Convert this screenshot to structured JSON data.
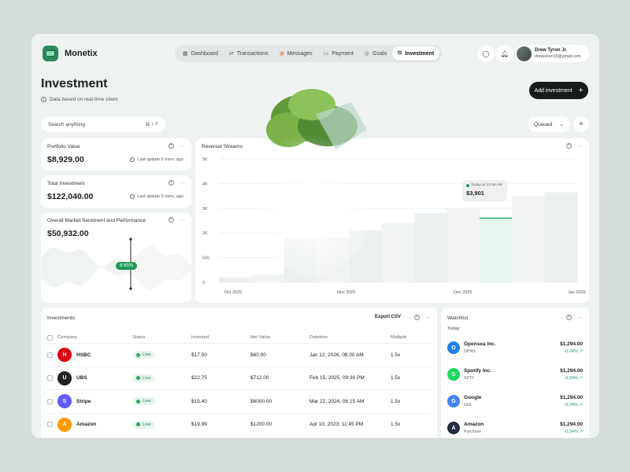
{
  "app": {
    "name": "Monetix"
  },
  "nav": [
    {
      "label": "Dashboard",
      "icon": "grid-icon"
    },
    {
      "label": "Transactions",
      "icon": "swap-icon"
    },
    {
      "label": "Messages",
      "icon": "chat-icon"
    },
    {
      "label": "Payment",
      "icon": "card-icon"
    },
    {
      "label": "Goals",
      "icon": "target-icon"
    },
    {
      "label": "Investment",
      "icon": "chart-icon",
      "active": true
    }
  ],
  "user": {
    "name": "Drew Tyron Jr.",
    "email": "drewishen15@gmail.com"
  },
  "page": {
    "title": "Investment",
    "subtitle": "Data based on real-time client"
  },
  "actions": {
    "add": "Add investment"
  },
  "search": {
    "placeholder": "Search anything",
    "shortcut": "⌘ + F"
  },
  "filter": {
    "selected": "Queued"
  },
  "cards": {
    "portfolio": {
      "title": "Portfolio Value",
      "value": "$8,929.00",
      "updated": "Last update 5 mins. ago"
    },
    "total": {
      "title": "Total Investment",
      "value": "$122,040.00",
      "updated": "Last update 5 mins. ago"
    },
    "sentiment": {
      "title": "Overall Market Sentiment and Performance",
      "value": "$50,932.00",
      "badge": "8.65%"
    }
  },
  "chart_data": {
    "type": "area",
    "title": "Revenue Streams",
    "yticks": [
      "5K",
      "4K",
      "3K",
      "2K",
      "500",
      "0"
    ],
    "xticks": [
      "Oct 2025",
      "Nov 2025",
      "Dec 2025",
      "Jan 2026"
    ],
    "values": [
      200,
      300,
      1800,
      1850,
      2100,
      2400,
      2800,
      3000,
      2600,
      3500,
      3650
    ],
    "highlight_index": 8,
    "tooltip": {
      "label": "Today at 12:05 AM",
      "value": "$3,901"
    },
    "grid": true
  },
  "investments": {
    "title": "Investments",
    "export": "Export CSV",
    "columns": [
      "Company",
      "Status",
      "Invested",
      "Net Value",
      "Datetime",
      "Multiple"
    ],
    "rows": [
      {
        "company": "HSBC",
        "status": "Live",
        "invested": "$17.50",
        "net": "$60.00",
        "datetime": "Jan 12, 2026, 08.00 AM",
        "multiple": "1.5x",
        "color": "#db0011"
      },
      {
        "company": "UBS",
        "status": "Live",
        "invested": "$22.75",
        "net": "$712.00",
        "datetime": "Feb 15, 2025, 09:30 PM",
        "multiple": "1.5x",
        "color": "#222222"
      },
      {
        "company": "Stripe",
        "status": "Live",
        "invested": "$15.40",
        "net": "$6000.00",
        "datetime": "Mar 22, 2024, 06:15 AM",
        "multiple": "1.5x",
        "color": "#635bff"
      },
      {
        "company": "Amazon",
        "status": "Live",
        "invested": "$19.99",
        "net": "$1200.00",
        "datetime": "Apr 10, 2023, 11:45 PM",
        "multiple": "1.5x",
        "color": "#ff9900"
      }
    ]
  },
  "watchlist": {
    "title": "Watchlist",
    "period": "Today",
    "items": [
      {
        "name": "Opensea Inc.",
        "ticker": "OPNS",
        "price": "$1,294.00",
        "change": "-0.24% ↗",
        "color": "#2081e2"
      },
      {
        "name": "Spotify Inc.",
        "ticker": "SPTF",
        "price": "$1,294.00",
        "change": "-0.24% ↗",
        "color": "#1ed760"
      },
      {
        "name": "Google",
        "ticker": "GGL",
        "price": "$1,294.00",
        "change": "-0.24% ↗",
        "color": "#4285f4"
      },
      {
        "name": "Amazon",
        "ticker": "Purchase",
        "price": "$1,294.00",
        "change": "-0.24% ↗",
        "color": "#232f3e"
      }
    ]
  }
}
